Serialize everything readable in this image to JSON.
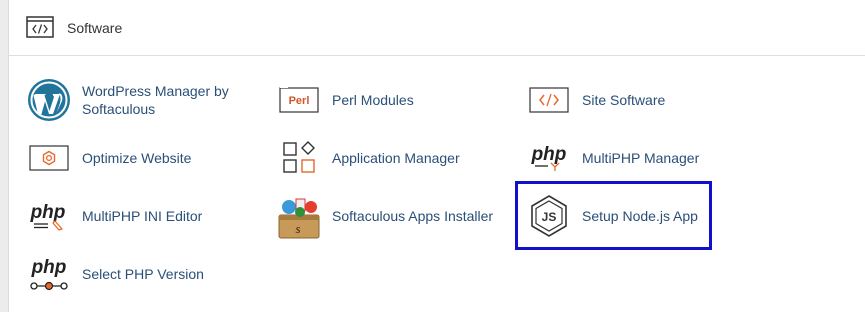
{
  "section": {
    "title": "Software",
    "icon": "code-brackets-icon"
  },
  "items": [
    {
      "label": "WordPress Manager by Softaculous",
      "icon": "wordpress-icon"
    },
    {
      "label": "Perl Modules",
      "icon": "perl-icon"
    },
    {
      "label": "Site Software",
      "icon": "code-brackets-icon"
    },
    {
      "label": "Optimize Website",
      "icon": "optimize-gear-icon"
    },
    {
      "label": "Application Manager",
      "icon": "application-manager-icon"
    },
    {
      "label": "MultiPHP Manager",
      "icon": "php-icon"
    },
    {
      "label": "MultiPHP INI Editor",
      "icon": "php-editor-icon"
    },
    {
      "label": "Softaculous Apps Installer",
      "icon": "softaculous-icon"
    },
    {
      "label": "Setup Node.js App",
      "icon": "nodejs-icon"
    },
    {
      "label": "Select PHP Version",
      "icon": "php-version-icon"
    }
  ],
  "icon_text": {
    "perl": "Perl",
    "php": "php",
    "js": "JS"
  },
  "colors": {
    "link": "#2a4f78",
    "highlight": "#1111cc",
    "wordpress": "#21759b",
    "accent_orange": "#e8682b"
  }
}
